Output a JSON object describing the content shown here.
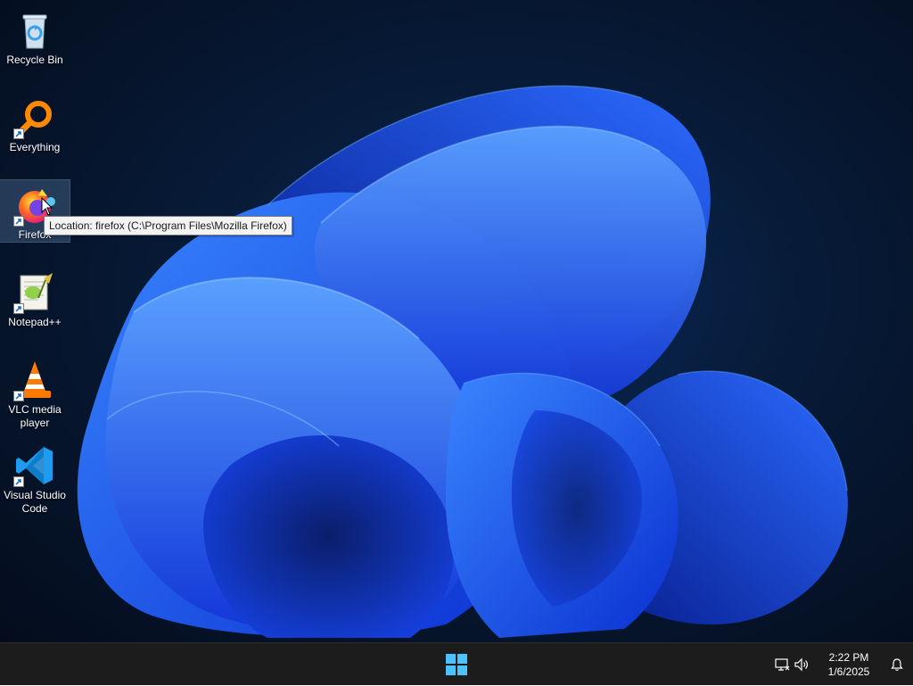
{
  "desktop": {
    "icons": [
      {
        "label": "Recycle Bin",
        "icon": "recycle-bin-icon"
      },
      {
        "label": "Everything",
        "icon": "everything-search-icon"
      },
      {
        "label": "Firefox",
        "icon": "firefox-icon"
      },
      {
        "label": "Notepad++",
        "icon": "notepad-plus-plus-icon"
      },
      {
        "label": "VLC media player",
        "icon": "vlc-cone-icon"
      },
      {
        "label": "Visual Studio Code",
        "icon": "vscode-icon"
      }
    ],
    "selected_icon": "Firefox",
    "tooltip": "Location: firefox (C:\\Program Files\\Mozilla Firefox)"
  },
  "taskbar": {
    "start_icon": "windows-logo-icon",
    "tray": {
      "network_icon": "network-icon",
      "volume_icon": "volume-icon",
      "notification_icon": "notification-bell-icon"
    },
    "clock": {
      "time": "2:22 PM",
      "date": "1/6/2025"
    }
  },
  "colors": {
    "wallpaper_bloom": "#1e5bff",
    "wallpaper_background": "#071a36",
    "taskbar": "#1c1c1c",
    "start_logo": "#4cc2ff"
  }
}
